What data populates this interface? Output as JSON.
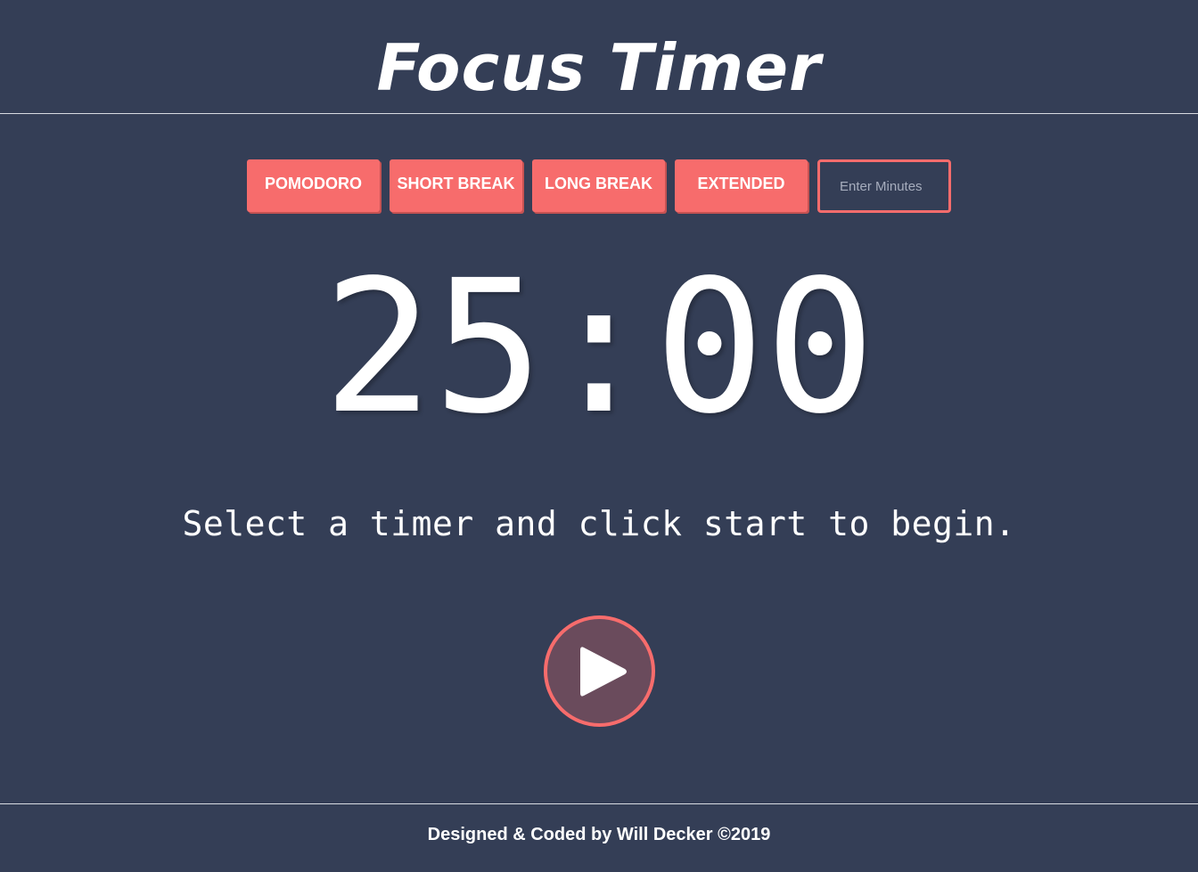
{
  "header": {
    "title": "Focus Timer"
  },
  "controls": {
    "buttons": [
      {
        "label": "POMODORO"
      },
      {
        "label": "SHORT BREAK"
      },
      {
        "label": "LONG BREAK"
      },
      {
        "label": "EXTENDED"
      }
    ],
    "minutes_input": {
      "value": "",
      "placeholder": "Enter Minutes"
    }
  },
  "timer": {
    "display": "25:00",
    "message": "Select a timer and click start to begin."
  },
  "play_button": {
    "icon": "play-icon"
  },
  "footer": {
    "credits": "Designed & Coded by Will Decker ©2019"
  },
  "colors": {
    "background": "#343e56",
    "accent": "#f76c6c",
    "play_fill": "#6a4b5c",
    "text": "#ffffff"
  }
}
